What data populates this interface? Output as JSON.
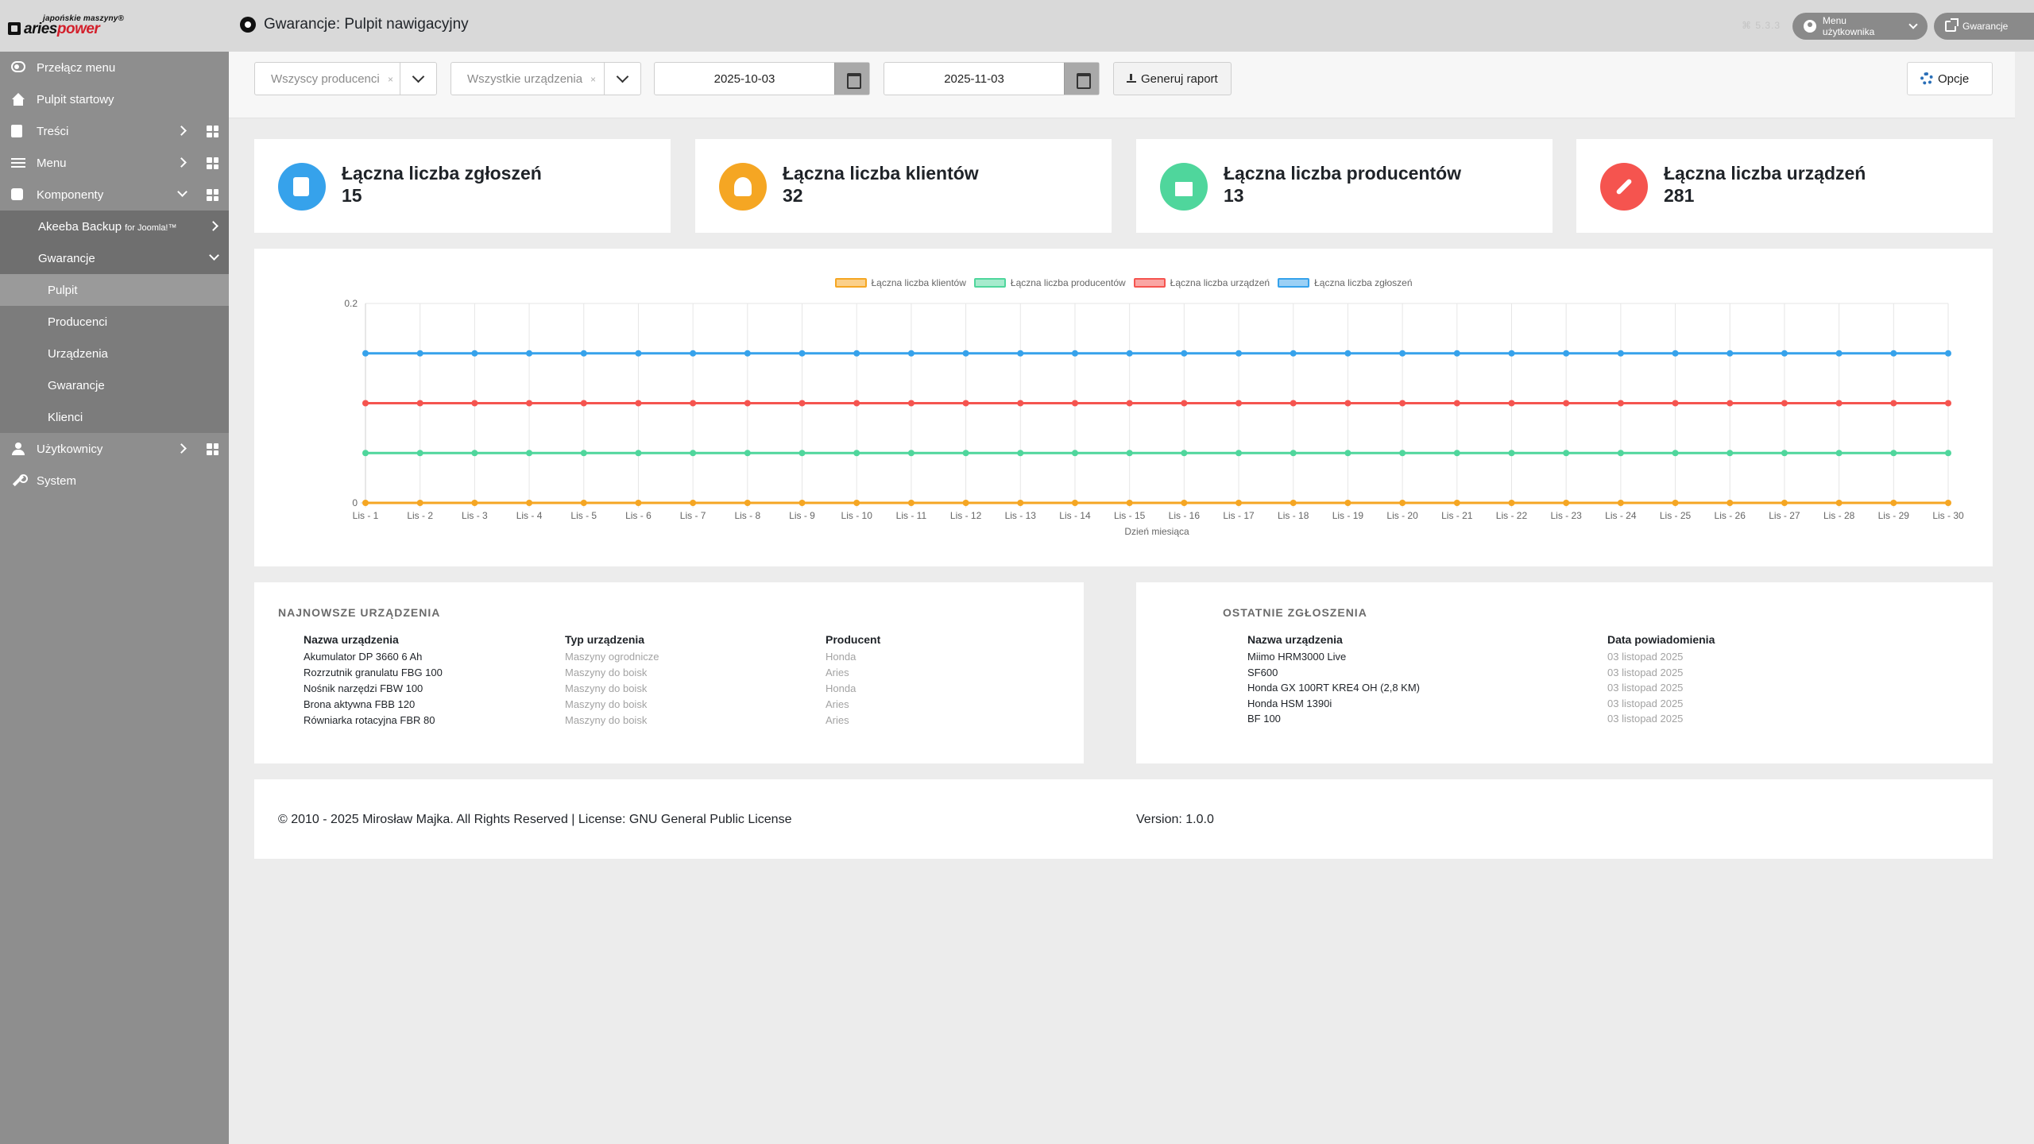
{
  "header": {
    "logo_tag": "japońskie maszyny®",
    "logo_brand_a": "aries",
    "logo_brand_b": "power",
    "page_title": "Gwarancje: Pulpit nawigacyjny",
    "version_hint": "⌘ 5.3.3",
    "user_menu_label": "Menu użytkownika",
    "site_link_label": "Gwarancje"
  },
  "sidebar": {
    "items": [
      {
        "label": "Przełącz menu",
        "icon": "toggle-icon"
      },
      {
        "label": "Pulpit startowy",
        "icon": "home-icon"
      },
      {
        "label": "Treści",
        "icon": "file-icon"
      },
      {
        "label": "Menu",
        "icon": "list-icon"
      },
      {
        "label": "Komponenty",
        "icon": "puzzle-icon"
      },
      {
        "label": "Akeeba Backup",
        "label_small": "for Joomla!™"
      },
      {
        "label": "Gwarancje"
      },
      {
        "label": "Pulpit"
      },
      {
        "label": "Producenci"
      },
      {
        "label": "Urządzenia"
      },
      {
        "label": "Gwarancje"
      },
      {
        "label": "Klienci"
      },
      {
        "label": "Użytkownicy",
        "icon": "users-icon"
      },
      {
        "label": "System",
        "icon": "wrench-icon"
      }
    ]
  },
  "toolbar": {
    "producer_filter": "Wszyscy producenci",
    "device_filter": "Wszystkie urządzenia",
    "clear_symbol": "×",
    "date_from": "2025-10-03",
    "date_to": "2025-11-03",
    "report_button": "Generuj raport",
    "options_button": "Opcje"
  },
  "stats": [
    {
      "title": "Łączna liczba zgłoszeń",
      "value": "15",
      "color": "#36a2eb",
      "icon": "clipboard-icon"
    },
    {
      "title": "Łączna liczba klientów",
      "value": "32",
      "color": "#f5a623",
      "icon": "users-icon"
    },
    {
      "title": "Łączna liczba producentów",
      "value": "13",
      "color": "#4fd69c",
      "icon": "factory-icon"
    },
    {
      "title": "Łączna liczba urządzeń",
      "value": "281",
      "color": "#f5544f",
      "icon": "tools-icon"
    }
  ],
  "chart_data": {
    "type": "line",
    "xlabel": "Dzień miesiąca",
    "ylabel": "",
    "ylim": [
      0,
      0.2
    ],
    "y_ticks": [
      "0.2",
      "0"
    ],
    "categories": [
      "Lis - 1",
      "Lis - 2",
      "Lis - 3",
      "Lis - 4",
      "Lis - 5",
      "Lis - 6",
      "Lis - 7",
      "Lis - 8",
      "Lis - 9",
      "Lis - 10",
      "Lis - 11",
      "Lis - 12",
      "Lis - 13",
      "Lis - 14",
      "Lis - 15",
      "Lis - 16",
      "Lis - 17",
      "Lis - 18",
      "Lis - 19",
      "Lis - 20",
      "Lis - 21",
      "Lis - 22",
      "Lis - 23",
      "Lis - 24",
      "Lis - 25",
      "Lis - 26",
      "Lis - 27",
      "Lis - 28",
      "Lis - 29",
      "Lis - 30"
    ],
    "series": [
      {
        "name": "Łączna liczba klientów",
        "color": "#f5a623",
        "values": [
          0,
          0,
          0,
          0,
          0,
          0,
          0,
          0,
          0,
          0,
          0,
          0,
          0,
          0,
          0,
          0,
          0,
          0,
          0,
          0,
          0,
          0,
          0,
          0,
          0,
          0,
          0,
          0,
          0,
          0
        ]
      },
      {
        "name": "Łączna liczba producentów",
        "color": "#4fd69c",
        "values": [
          0.05,
          0.05,
          0.05,
          0.05,
          0.05,
          0.05,
          0.05,
          0.05,
          0.05,
          0.05,
          0.05,
          0.05,
          0.05,
          0.05,
          0.05,
          0.05,
          0.05,
          0.05,
          0.05,
          0.05,
          0.05,
          0.05,
          0.05,
          0.05,
          0.05,
          0.05,
          0.05,
          0.05,
          0.05,
          0.05
        ]
      },
      {
        "name": "Łączna liczba urządzeń",
        "color": "#f5544f",
        "values": [
          0.1,
          0.1,
          0.1,
          0.1,
          0.1,
          0.1,
          0.1,
          0.1,
          0.1,
          0.1,
          0.1,
          0.1,
          0.1,
          0.1,
          0.1,
          0.1,
          0.1,
          0.1,
          0.1,
          0.1,
          0.1,
          0.1,
          0.1,
          0.1,
          0.1,
          0.1,
          0.1,
          0.1,
          0.1,
          0.1
        ]
      },
      {
        "name": "Łączna liczba zgłoszeń",
        "color": "#36a2eb",
        "values": [
          0.15,
          0.15,
          0.15,
          0.15,
          0.15,
          0.15,
          0.15,
          0.15,
          0.15,
          0.15,
          0.15,
          0.15,
          0.15,
          0.15,
          0.15,
          0.15,
          0.15,
          0.15,
          0.15,
          0.15,
          0.15,
          0.15,
          0.15,
          0.15,
          0.15,
          0.15,
          0.15,
          0.15,
          0.15,
          0.15
        ]
      }
    ],
    "grid": true,
    "legend": "top-center"
  },
  "newest_devices": {
    "heading": "NAJNOWSZE URZĄDZENIA",
    "columns": [
      "Nazwa urządzenia",
      "Typ urządzenia",
      "Producent"
    ],
    "rows": [
      [
        "Akumulator DP 3660 6 Ah",
        "Maszyny ogrodnicze",
        "Honda"
      ],
      [
        "Rozrzutnik granulatu FBG 100",
        "Maszyny do boisk",
        "Aries"
      ],
      [
        "Nośnik narzędzi FBW 100",
        "Maszyny do boisk",
        "Honda"
      ],
      [
        "Brona aktywna FBB 120",
        "Maszyny do boisk",
        "Aries"
      ],
      [
        "Równiarka rotacyjna FBR 80",
        "Maszyny do boisk",
        "Aries"
      ]
    ]
  },
  "recent_claims": {
    "heading": "OSTATNIE ZGŁOSZENIA",
    "columns": [
      "Nazwa urządzenia",
      "Data powiadomienia"
    ],
    "rows": [
      [
        "Miimo HRM3000 Live",
        "03 listopad 2025"
      ],
      [
        "SF600",
        "03 listopad 2025"
      ],
      [
        "Honda GX 100RT KRE4 OH (2,8 KM)",
        "03 listopad 2025"
      ],
      [
        "Honda HSM 1390i",
        "03 listopad 2025"
      ],
      [
        "BF 100",
        "03 listopad 2025"
      ]
    ]
  },
  "footer": {
    "copyright": "© 2010 - 2025 Mirosław Majka. All Rights Reserved | License: GNU General Public License",
    "version": "Version: 1.0.0"
  }
}
